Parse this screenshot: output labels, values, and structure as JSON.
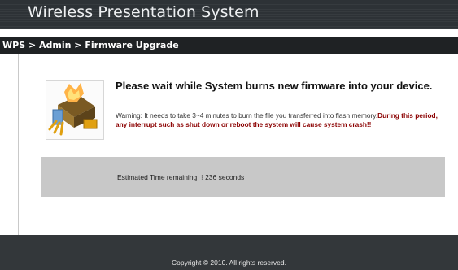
{
  "header": {
    "title": "Wireless Presentation System"
  },
  "breadcrumb": "WPS > Admin > Firmware Upgrade",
  "main": {
    "icon": "firmware-chip-icon",
    "heading": "Please wait while System burns new firmware into your device.",
    "warning_text": "Warning: It needs to take 3~4 minutes to burn the file you transferred into flash memory.",
    "warning_emphasis": "During this period, any interrupt such as shut down or reboot the system will cause system crash!!",
    "estimate_label": "Estimated Time remaining:",
    "estimate_value": "236",
    "estimate_unit": "seconds"
  },
  "footer": {
    "copyright": "Copyright © 2010. All rights reserved."
  },
  "colors": {
    "header_bg": "#2d3236",
    "breadcrumb_bg": "#1f2224",
    "footer_bg": "#33373a",
    "estimate_box_bg": "#c8c8c8",
    "warning_emphasis": "#8b0000"
  }
}
